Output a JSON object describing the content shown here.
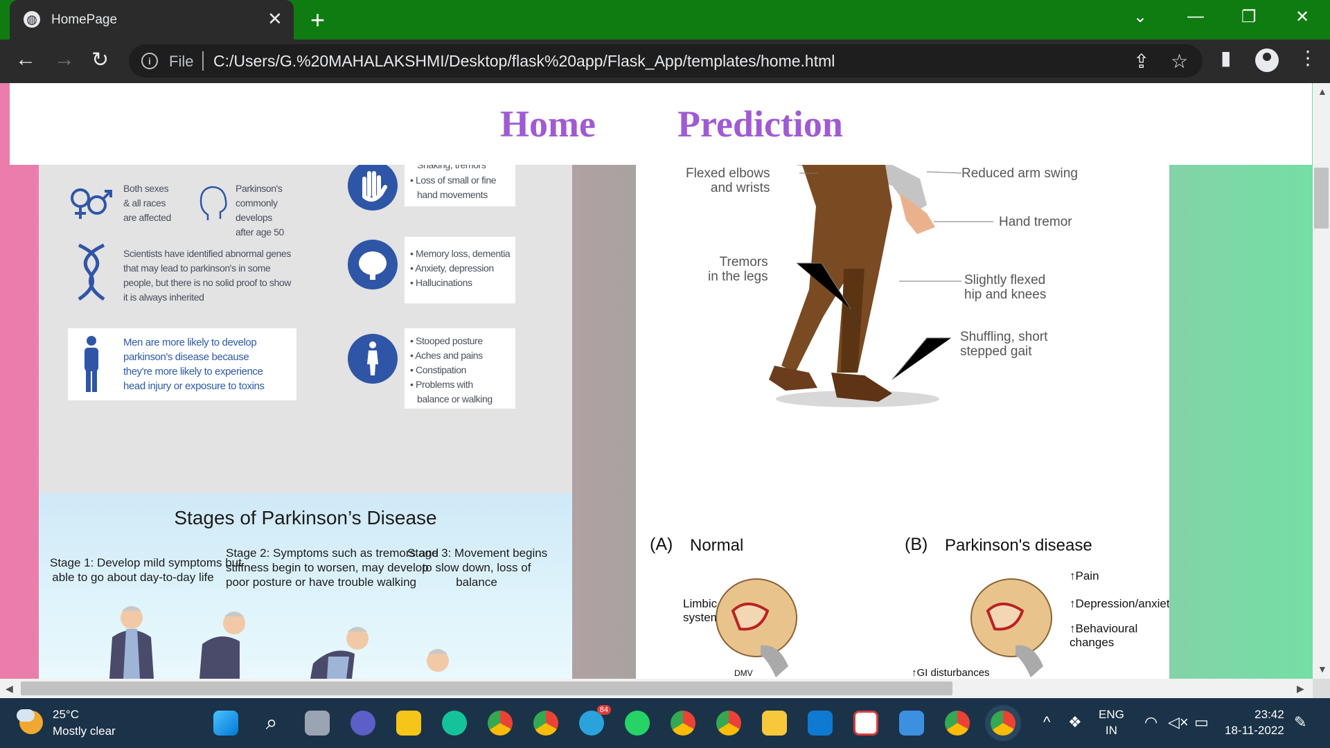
{
  "browser": {
    "tab_title": "HomePage",
    "tab_close": "✕",
    "new_tab": "+",
    "window_controls": {
      "collapse": "⌄",
      "minimize": "—",
      "restore": "❐",
      "close": "✕"
    },
    "nav": {
      "back": "←",
      "forward": "→",
      "reload": "↻"
    },
    "file_label": "File",
    "url": "C:/Users/G.%20MAHALAKSHMI/Desktop/flask%20app/Flask_App/templates/home.html",
    "icons": {
      "info": "i",
      "share": "⇪",
      "bookmark": "☆",
      "sidepanel": "▮",
      "menu": "⋮"
    }
  },
  "page": {
    "nav": {
      "home": "Home",
      "prediction": "Prediction"
    },
    "info_card": {
      "top_fragment": "Shaking, tremors",
      "sexes": "Both sexes\n& all races\nare affected",
      "age": "Parkinson's\ncommonly\ndevelops\nafter age 50",
      "genes": "Scientists have identified abnormal genes\nthat may lead to parkinson's in some\npeople, but there is no solid proof to show\nit is always inherited",
      "men": "Men are more likely to develop\nparkinson's disease because\nthey're more likely to experience\nhead injury or exposure to toxins",
      "hand_bullets": [
        "Loss of small or fine",
        "hand movements"
      ],
      "brain_bullets": [
        "Memory loss, dementia",
        "Anxiety, depression",
        "Hallucinations"
      ],
      "body_bullets": [
        "Stooped posture",
        "Aches and pains",
        "Constipation",
        "Problems with",
        "balance or walking"
      ]
    },
    "symptom_card": {
      "flexed_elbows": "Flexed elbows\nand wrists",
      "reduced_arm": "Reduced arm swing",
      "hand_tremor": "Hand tremor",
      "tremors_legs": "Tremors\nin the legs",
      "flexed_hip": "Slightly flexed\nhip and knees",
      "gait": "Shuffling, short\nstepped gait"
    },
    "stages_card": {
      "title": "Stages of Parkinson’s Disease",
      "stage1": "Stage 1: Develop mild symptoms but\nable to go about day-to-day life",
      "stage2": "Stage 2: Symptoms such as tremors and\nstiffness begin to worsen, may develop\npoor posture or have trouble walking",
      "stage3": "Stage 3: Movement begins\nto slow down, loss of\nbalance"
    },
    "brain_card": {
      "a_label": "(A)",
      "a_title": "Normal",
      "limbic": "Limbic\nsystem",
      "dmv": "DMV",
      "b_label": "(B)",
      "b_title": "Parkinson's disease",
      "pain": "Pain",
      "depression": "Depression/anxiety",
      "behavioural": "Behavioural\nchanges",
      "gi": "GI disturbances"
    }
  },
  "taskbar": {
    "temperature": "25°C",
    "weather": "Mostly clear",
    "telegram_badge": "84",
    "lang_top": "ENG",
    "lang_bottom": "IN",
    "time": "23:42",
    "date": "18-11-2022",
    "chevron": "^"
  },
  "colors": {
    "tabbar": "#0f7c12",
    "chrome": "#2b2b2b",
    "nav_link": "#a05ad4",
    "icon_blue": "#2f56a6",
    "gradient_left": "#ec7cab",
    "gradient_right": "#74dea5",
    "taskbar": "#1b3348"
  }
}
